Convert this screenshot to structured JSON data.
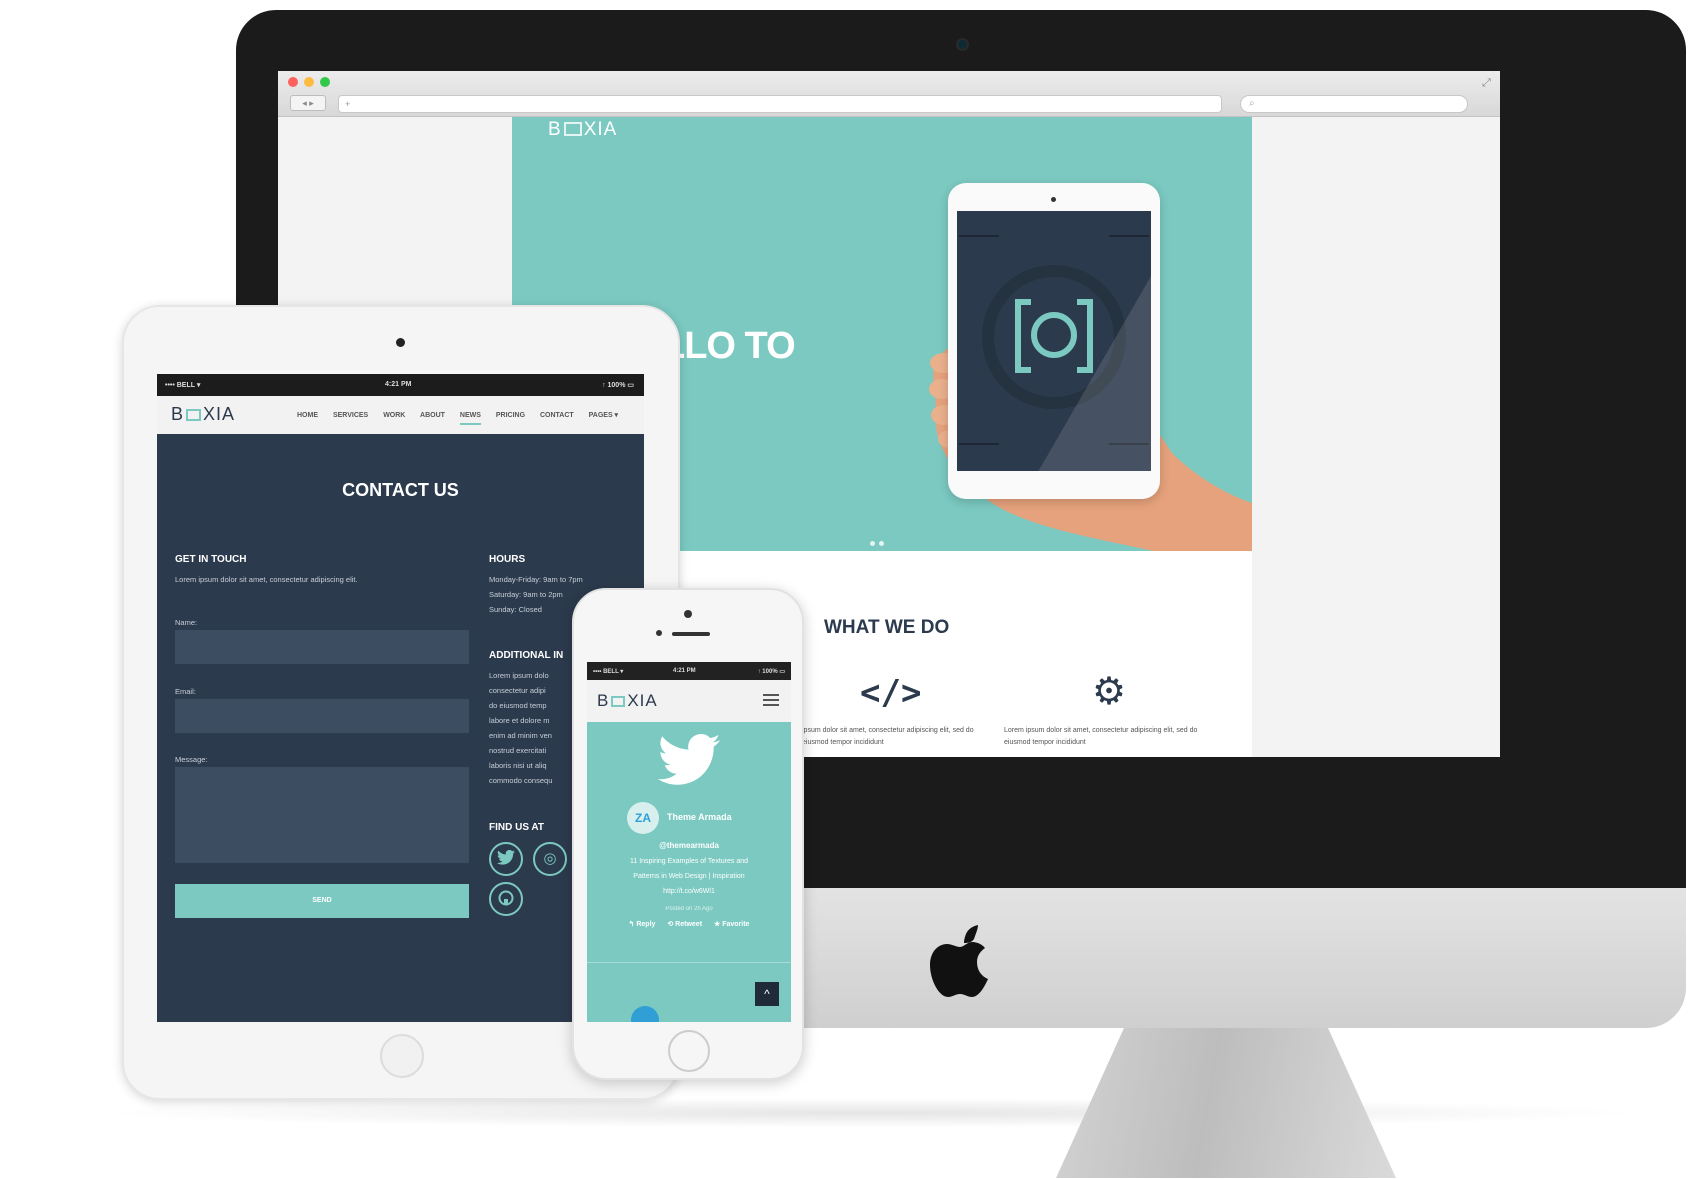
{
  "desktop": {
    "browser": {
      "url_text": "+",
      "search_icon": "search-icon",
      "nav_text": "◂ ▸"
    },
    "site": {
      "logo": {
        "pre": "B",
        "post": "XIA"
      },
      "hero_text": "LLO TO",
      "what_we_do_title": "WHAT WE DO",
      "features": [
        {
          "icon": "code-icon",
          "symbol": "</>",
          "text": "ipsum dolor sit amet, consectetur adipiscing elit, sed do eiusmod tempor incididunt"
        },
        {
          "icon": "gear-icon",
          "symbol": "⚙",
          "text": "Lorem ipsum dolor sit amet, consectetur adipiscing elit, sed do eiusmod tempor incididunt"
        }
      ]
    }
  },
  "tablet": {
    "status": {
      "carrier": "•••• BELL ▾",
      "time": "4:21 PM",
      "battery": "↑ 100% ▭"
    },
    "logo": {
      "pre": "B",
      "post": "XIA"
    },
    "menu": [
      "HOME",
      "SERVICES",
      "WORK",
      "ABOUT",
      "NEWS",
      "PRICING",
      "CONTACT",
      "PAGES ▾"
    ],
    "active_menu": "NEWS",
    "page_title": "CONTACT US",
    "get_in_touch": {
      "heading": "GET IN TOUCH",
      "text": "Lorem ipsum dolor sit amet, consectetur adipiscing elit."
    },
    "form": {
      "name_label": "Name:",
      "email_label": "Email:",
      "message_label": "Message:",
      "send_label": "SEND"
    },
    "hours": {
      "heading": "HOURS",
      "lines": [
        "Monday-Friday: 9am to 7pm",
        "Saturday: 9am to 2pm",
        "Sunday: Closed"
      ]
    },
    "additional": {
      "heading": "ADDITIONAL IN",
      "lines": [
        "Lorem ipsum dolo",
        "consectetur adipi",
        "do eiusmod temp",
        "labore et dolore m",
        "enim ad minim ven",
        "nostrud exercitati",
        "laboris nisi ut aliq",
        "commodo consequ"
      ]
    },
    "find_us": {
      "heading": "FIND US AT",
      "icons": [
        "twitter-icon",
        "dribbble-icon",
        "github-icon"
      ]
    }
  },
  "phone": {
    "status": {
      "carrier": "•••• BELL ▾",
      "time": "4:21 PM",
      "battery": "↑ 100% ▭"
    },
    "logo": {
      "pre": "B",
      "post": "XIA"
    },
    "tweet": {
      "avatar_text": "ZA",
      "name": "Theme Armada",
      "handle": "@themearmada",
      "text_lines": [
        "11 Inspiring Examples of Textures and",
        "Patterns in Web Design | Inspiration",
        "http://t.co/w6Wl1"
      ],
      "posted": "Posted on 2h Ago",
      "actions": [
        "↰ Reply",
        "⟲ Retweet",
        "★ Favorite"
      ]
    },
    "back_to_top": "^"
  },
  "colors": {
    "accent": "#7bc9c1",
    "dark": "#2c3a4d",
    "twitter": "#2f9fd5"
  }
}
